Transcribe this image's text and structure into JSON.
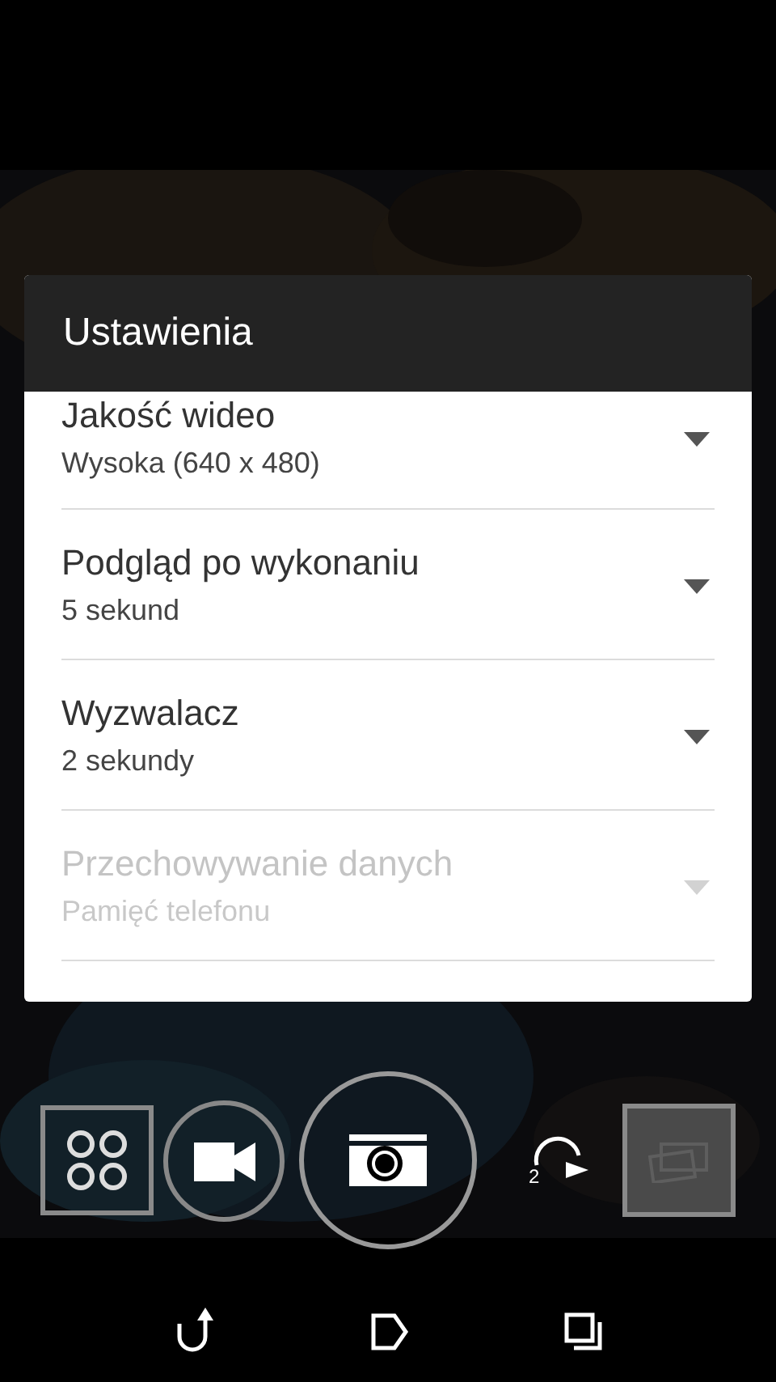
{
  "dialog": {
    "title": "Ustawienia",
    "settings": [
      {
        "label": "Jakość wideo",
        "value": "Wysoka (640 x 480)",
        "disabled": false
      },
      {
        "label": "Podgląd po wykonaniu",
        "value": "5 sekund",
        "disabled": false
      },
      {
        "label": "Wyzwalacz",
        "value": "2 sekundy",
        "disabled": false
      },
      {
        "label": "Przechowywanie danych",
        "value": "Pamięć telefonu",
        "disabled": true
      }
    ]
  },
  "camera_controls": {
    "timer": "2"
  }
}
